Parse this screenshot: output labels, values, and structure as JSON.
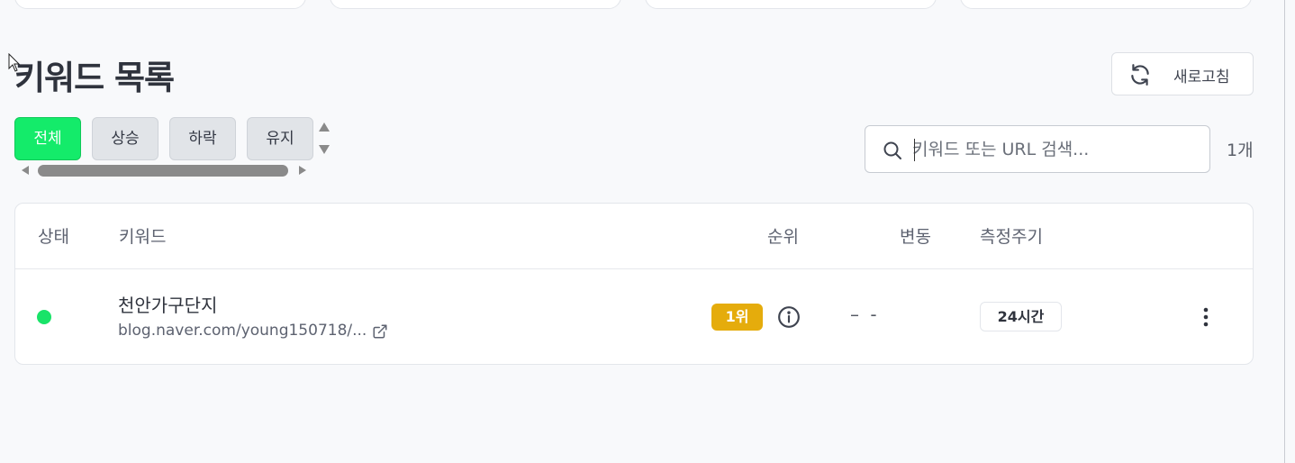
{
  "page": {
    "title": "키워드 목록",
    "refresh_label": "새로고침"
  },
  "filters": [
    {
      "label": "전체",
      "active": true
    },
    {
      "label": "상승",
      "active": false
    },
    {
      "label": "하락",
      "active": false
    },
    {
      "label": "유지",
      "active": false
    }
  ],
  "search": {
    "placeholder": "키워드 또는 URL 검색...",
    "value": ""
  },
  "result_count": "1개",
  "table": {
    "columns": [
      "상태",
      "키워드",
      "순위",
      "변동",
      "측정주기"
    ],
    "rows": [
      {
        "status_color": "#19e368",
        "keyword": "천안가구단지",
        "url": "blog.naver.com/young150718/...",
        "rank": "1위",
        "change": "– -",
        "interval": "24시간"
      }
    ]
  },
  "colors": {
    "accent": "#14eb6a",
    "rank_badge": "#e5ac0c"
  },
  "icons": {
    "refresh": "refresh-icon",
    "search": "search-icon",
    "external_link": "external-link-icon",
    "info": "info-icon",
    "more": "more-vertical-icon"
  }
}
